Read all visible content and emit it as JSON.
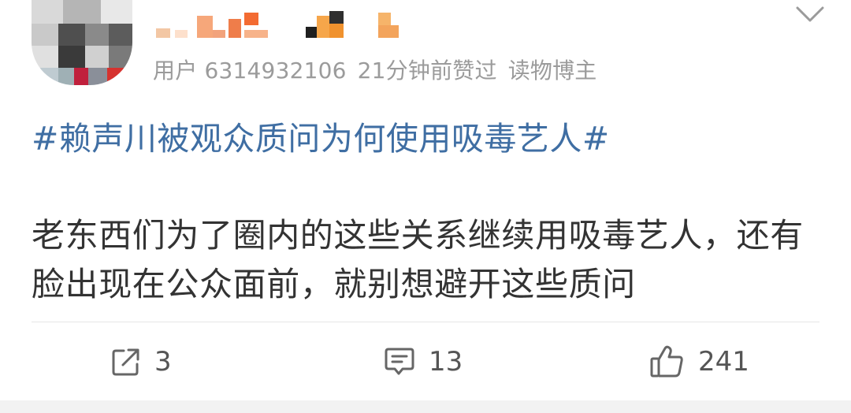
{
  "post": {
    "user_id": "用户 6314932106",
    "time": "21分钟前赞过",
    "role": "读物博主",
    "topic": "#赖声川被观众质问为何使用吸毒艺人#",
    "content": "老东西们为了圈内的这些关系继续用吸毒艺人，还有脸出现在公众面前，就别想避开这些质问"
  },
  "actions": {
    "repost_count": "3",
    "comment_count": "13",
    "like_count": "241"
  },
  "icons": {
    "menu": "chevron-down-icon",
    "repost": "share-icon",
    "comment": "comment-icon",
    "like": "thumbs-up-icon"
  },
  "colors": {
    "topic": "#3f6ea3",
    "meta": "#9b9b9b",
    "text": "#333333"
  }
}
